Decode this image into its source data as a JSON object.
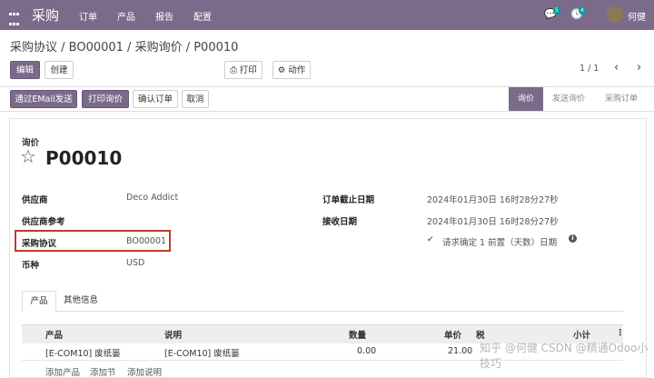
{
  "topbar": {
    "app_name": "采购",
    "menu": [
      "订单",
      "产品",
      "报告",
      "配置"
    ],
    "msg_count": "5",
    "activity_count": "4",
    "user": "何健"
  },
  "breadcrumb": "采购协议 / BO00001 / 采购询价 / P00010",
  "toolbar": {
    "edit": "编辑",
    "create": "创建",
    "print": "⎙ 打印",
    "action": "⚙ 动作",
    "pager": "1 / 1",
    "prev": "‹",
    "next": "›"
  },
  "actions": {
    "send_email": "通过EMail发送",
    "print_rfq": "打印询价",
    "confirm": "确认订单",
    "cancel": "取消"
  },
  "status_stages": [
    "询价",
    "发送询价",
    "采购订单"
  ],
  "form": {
    "doc_type": "询价",
    "name": "P00010",
    "vendor_label": "供应商",
    "vendor": "Deco Addict",
    "vendor_ref_label": "供应商参考",
    "agreement_label": "采购协议",
    "agreement": "BO00001",
    "currency_label": "币种",
    "currency": "USD",
    "order_deadline_label": "订单截止日期",
    "order_deadline": "2024年01月30日 16时28分27秒",
    "receipt_date_label": "接收日期",
    "receipt_date": "2024年01月30日 16时28分27秒",
    "confirm_text": "请求确定 1 前置（天数）日期"
  },
  "tabs": [
    "产品",
    "其他信息"
  ],
  "table": {
    "headers": [
      "产品",
      "说明",
      "数量",
      "单价",
      "税",
      "小计"
    ],
    "rows": [
      {
        "product": "[E-COM10] 废纸篓",
        "desc": "[E-COM10] 废纸篓",
        "qty": "0.00",
        "price": "21.00",
        "tax": "",
        "subtotal": ""
      }
    ],
    "add_links": [
      "添加产品",
      "添加节",
      "添加说明"
    ]
  },
  "watermark": "知乎 @何健 CSDN @精通Odoo小技巧"
}
